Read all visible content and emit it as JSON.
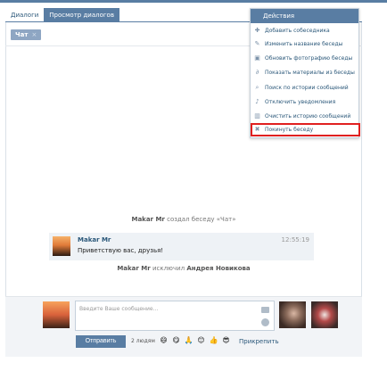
{
  "tabs": [
    {
      "label": "Диалоги",
      "active": false
    },
    {
      "label": "Просмотр диалогов",
      "active": true
    }
  ],
  "chat_chip": {
    "label": "Чат",
    "close": "×"
  },
  "menu": {
    "header": "Действия",
    "items": [
      {
        "icon": "plus-icon",
        "label": "Добавить собеседника"
      },
      {
        "icon": "pencil-icon",
        "label": "Изменить название беседы"
      },
      {
        "icon": "camera-icon",
        "label": "Обновить фотографию беседы"
      },
      {
        "icon": "paperclip-icon",
        "label": "Показать материалы из беседы"
      },
      {
        "icon": "search-icon",
        "label": "Поиск по истории сообщений"
      },
      {
        "icon": "mute-icon",
        "label": "Отключить уведомления"
      },
      {
        "icon": "trash-icon",
        "label": "Очистить историю сообщений"
      },
      {
        "icon": "close-icon",
        "label": "Покинуть беседу",
        "highlighted": true
      }
    ]
  },
  "events": {
    "created": {
      "actor": "Makar Mr",
      "text": "создал беседу «Чат»"
    },
    "excluded": {
      "actor": "Makar Mr",
      "verb": "исключил",
      "target": "Андрея Новикова"
    }
  },
  "message": {
    "author": "Makar Mr",
    "text": "Приветствую вас, друзья!",
    "time": "12:55:19"
  },
  "composer": {
    "placeholder": "Введите Ваше сообщение...",
    "send_label": "Отправить",
    "people_count": "2 людям",
    "attach_label": "Прикрепить",
    "emojis": [
      "😄",
      "😋",
      "🙏",
      "😊",
      "👍",
      "😎"
    ]
  },
  "colors": {
    "accent": "#597da3",
    "link": "#2b587a",
    "highlight_border": "#e02020"
  }
}
